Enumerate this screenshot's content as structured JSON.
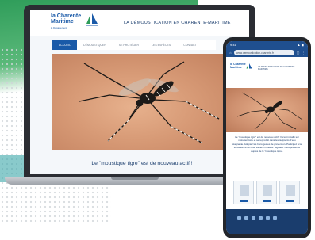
{
  "laptop": {
    "logo_line1": "la Charente",
    "logo_line2": "Maritime",
    "logo_sub": "le Département",
    "site_title": "LA DÉMOUSTICATION EN CHARENTE-MARITIME",
    "nav": [
      {
        "label": "ACCUEIL",
        "active": true
      },
      {
        "label": "DÉMOUSTIQUER",
        "active": false
      },
      {
        "label": "SE PROTÉGER",
        "active": false
      },
      {
        "label": "LES ESPÈCES",
        "active": false
      },
      {
        "label": "CONTACT",
        "active": false
      }
    ],
    "caption": "Le \"moustique tigre\" est de nouveau actif !"
  },
  "phone": {
    "time": "9:41",
    "status_right": "▲ ◼",
    "url": "www.demoustication-charente.fr",
    "logo_line1": "la Charente",
    "logo_line2": "Maritime",
    "title": "LA DÉMOUSTICATION EN CHARENTE-MARITIME",
    "body": "Le \"moustique tigre\" est de nouveau actif ! Il s'est installé sur notre territoire et se reproduit dans les récipients d'eau stagnante. Adoptez les bons gestes de prévention. Participez à la surveillance de cette espèce invasive. Signalez votre présence auprès de le \"moustique tigre\"."
  },
  "colors": {
    "brand_blue": "#1a5aa8",
    "dark_blue": "#1a3d6d",
    "accent_green": "#2f9d5a"
  }
}
